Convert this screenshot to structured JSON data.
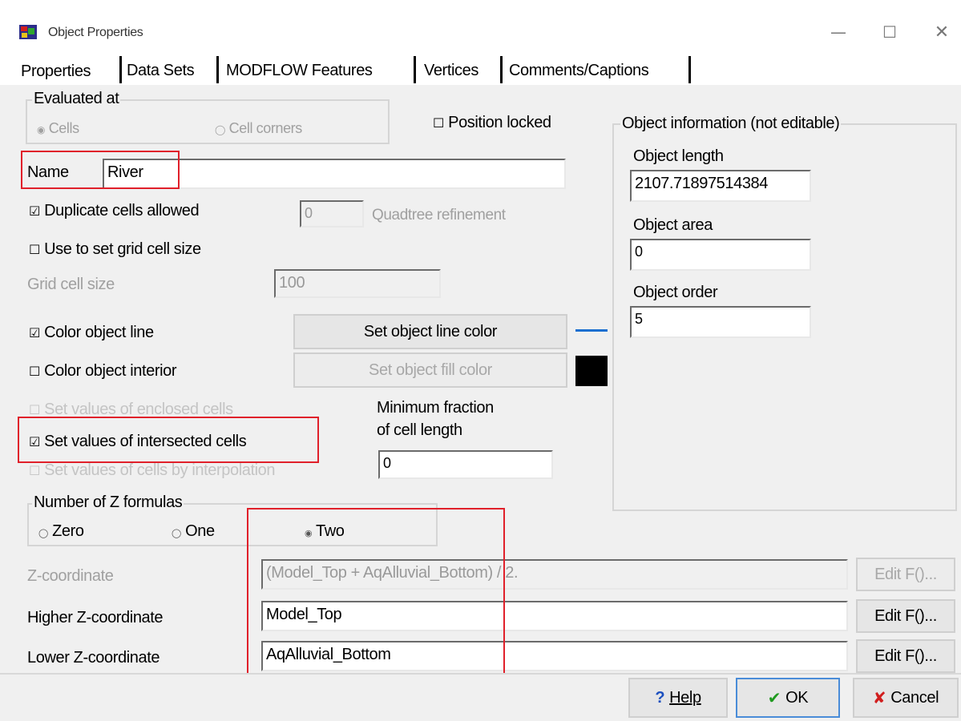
{
  "window": {
    "title": "Object Properties",
    "minimize": "—",
    "maximize": "☐",
    "close": "✕"
  },
  "tabs": [
    {
      "label": "Properties"
    },
    {
      "label": "Data Sets"
    },
    {
      "label": "MODFLOW Features"
    },
    {
      "label": "Vertices"
    },
    {
      "label": "Comments/Captions"
    }
  ],
  "evaluated_at": {
    "title": "Evaluated at",
    "option_cells": "Cells",
    "option_corners": "Cell corners"
  },
  "position_locked": {
    "label": "Position locked",
    "checked": false
  },
  "name": {
    "label": "Name",
    "value": "River"
  },
  "duplicate_cells": {
    "label": "Duplicate cells allowed",
    "checked": true
  },
  "quadtree": {
    "value": "0",
    "label": "Quadtree refinement"
  },
  "grid_size_flag": {
    "label": "Use to set grid cell size",
    "checked": false
  },
  "grid_cell_size": {
    "label": "Grid cell size",
    "value": "100"
  },
  "color_line": {
    "label": "Color object line",
    "checked": true,
    "button": "Set object line color",
    "swatch": "#1a6fd0"
  },
  "color_interior": {
    "label": "Color object interior",
    "checked": false,
    "button": "Set object fill color",
    "swatch": "#000000"
  },
  "enclosed": {
    "label": "Set values of enclosed cells"
  },
  "intersected": {
    "label": "Set values of intersected cells",
    "checked": true
  },
  "interpolation": {
    "label": "Set values of cells by interpolation"
  },
  "min_fraction": {
    "label_line1": "Minimum fraction",
    "label_line2": "of cell length",
    "value": "0"
  },
  "z_formulas": {
    "title": "Number of Z formulas",
    "zero": "Zero",
    "one": "One",
    "two": "Two",
    "selected": "Two"
  },
  "z_coordinate": {
    "label": "Z-coordinate",
    "value": "(Model_Top + AqAlluvial_Bottom) / 2.",
    "button": "Edit F()..."
  },
  "higher_z": {
    "label": "Higher Z-coordinate",
    "value": "Model_Top",
    "button": "Edit F()..."
  },
  "lower_z": {
    "label": "Lower Z-coordinate",
    "value": "AqAlluvial_Bottom",
    "button": "Edit F()..."
  },
  "object_info": {
    "title": "Object information (not editable)",
    "length_label": "Object length",
    "length_value": "2107.71897514384",
    "area_label": "Object area",
    "area_value": "0",
    "order_label": "Object order",
    "order_value": "5"
  },
  "footer": {
    "help_icon": "?",
    "help": "Help",
    "ok_icon": "✔",
    "ok": "OK",
    "cancel_icon": "✘",
    "cancel": "Cancel"
  },
  "colors": {
    "highlight": "#e0202a",
    "panel": "#f0f0f0"
  }
}
